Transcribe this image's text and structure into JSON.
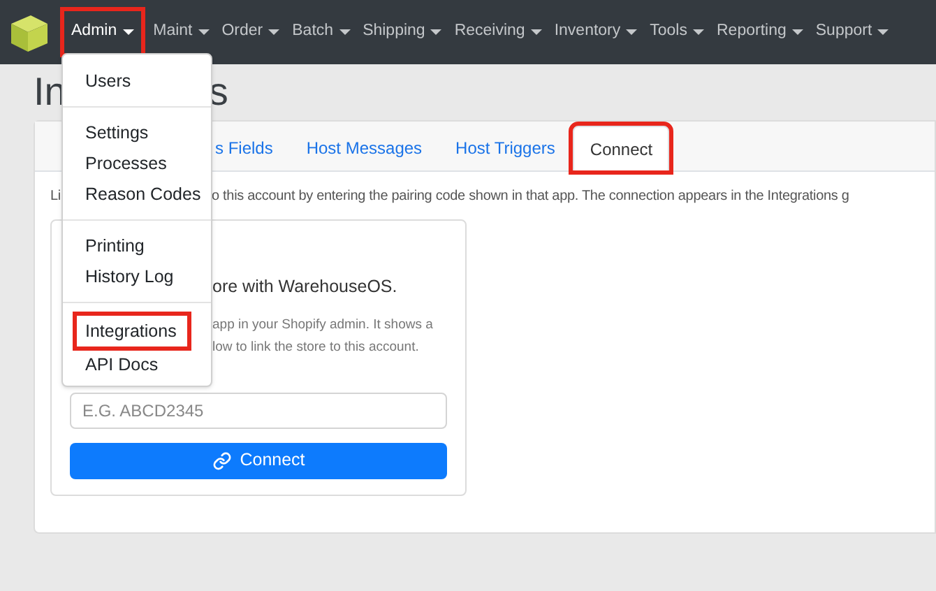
{
  "navbar": {
    "items": [
      {
        "label": "Admin",
        "highlighted": true
      },
      {
        "label": "Maint",
        "highlighted": false
      },
      {
        "label": "Order",
        "highlighted": false
      },
      {
        "label": "Batch",
        "highlighted": false
      },
      {
        "label": "Shipping",
        "highlighted": false
      },
      {
        "label": "Receiving",
        "highlighted": false
      },
      {
        "label": "Inventory",
        "highlighted": false
      },
      {
        "label": "Tools",
        "highlighted": false
      },
      {
        "label": "Reporting",
        "highlighted": false
      },
      {
        "label": "Support",
        "highlighted": false
      }
    ]
  },
  "dropdown": {
    "groups": [
      [
        {
          "label": "Users",
          "highlighted": false
        }
      ],
      [
        {
          "label": "Settings",
          "highlighted": false
        },
        {
          "label": "Processes",
          "highlighted": false
        },
        {
          "label": "Reason Codes",
          "highlighted": false
        }
      ],
      [
        {
          "label": "Printing",
          "highlighted": false
        },
        {
          "label": "History Log",
          "highlighted": false
        }
      ],
      [
        {
          "label": "Integrations",
          "highlighted": true
        },
        {
          "label": "API Docs",
          "highlighted": false
        }
      ]
    ]
  },
  "heading": {
    "visible_start": "In",
    "visible_end": "s"
  },
  "tabs": [
    {
      "label": "s Fields",
      "selected": false,
      "highlighted": false
    },
    {
      "label": "Host Messages",
      "selected": false,
      "highlighted": false
    },
    {
      "label": "Host Triggers",
      "selected": false,
      "highlighted": false
    },
    {
      "label": "Connect",
      "selected": true,
      "highlighted": true
    }
  ],
  "intro": {
    "visible_start": "Li",
    "visible_end": "o this account by entering the pairing code shown in that app. The connection appears in the Integrations g"
  },
  "connect_card": {
    "subtitle": "ore with WarehouseOS.",
    "help_lines": [
      "app in your Shopify admin. It shows a",
      "low to link the store to this account."
    ],
    "code_field": {
      "placeholder": "E.G. ABCD2345"
    },
    "button": "Connect"
  }
}
